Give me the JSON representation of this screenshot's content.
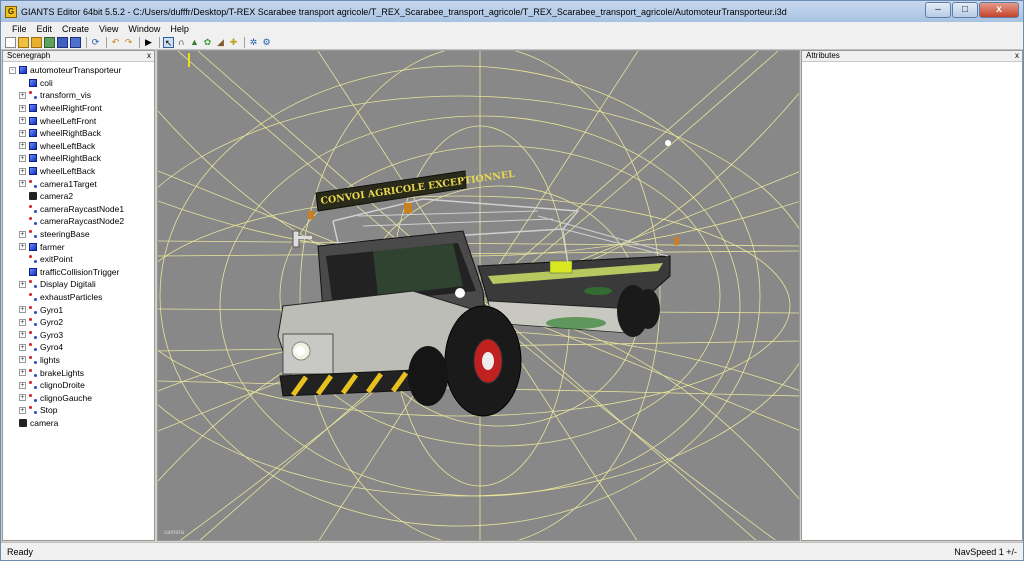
{
  "window": {
    "title": "GIANTS Editor 64bit 5.5.2 - C:/Users/dufffr/Desktop/T-REX Scarabee transport agricole/T_REX_Scarabee_transport_agricole/T_REX_Scarabee_transport_agricole/AutomoteurTransporteur.i3d",
    "minimize": "–",
    "maximize": "□",
    "close": "x"
  },
  "menu": [
    "File",
    "Edit",
    "Create",
    "View",
    "Window",
    "Help"
  ],
  "scenegraph": {
    "title": "Scenegraph",
    "close": "x",
    "nodes": [
      {
        "label": "automoteurTransporteur",
        "depth": 0,
        "expand": "-",
        "icon": "shape"
      },
      {
        "label": "coli",
        "depth": 1,
        "expand": "",
        "icon": "shape"
      },
      {
        "label": "transform_vis",
        "depth": 1,
        "expand": "+",
        "icon": "transform"
      },
      {
        "label": "wheelRightFront",
        "depth": 1,
        "expand": "+",
        "icon": "shape"
      },
      {
        "label": "wheelLeftFront",
        "depth": 1,
        "expand": "+",
        "icon": "shape"
      },
      {
        "label": "wheelRightBack",
        "depth": 1,
        "expand": "+",
        "icon": "shape"
      },
      {
        "label": "wheelLeftBack",
        "depth": 1,
        "expand": "+",
        "icon": "shape"
      },
      {
        "label": "wheelRightBack",
        "depth": 1,
        "expand": "+",
        "icon": "shape"
      },
      {
        "label": "wheelLeftBack",
        "depth": 1,
        "expand": "+",
        "icon": "shape"
      },
      {
        "label": "camera1Target",
        "depth": 1,
        "expand": "+",
        "icon": "transform"
      },
      {
        "label": "camera2",
        "depth": 1,
        "expand": "",
        "icon": "camera"
      },
      {
        "label": "cameraRaycastNode1",
        "depth": 1,
        "expand": "",
        "icon": "transform"
      },
      {
        "label": "cameraRaycastNode2",
        "depth": 1,
        "expand": "",
        "icon": "transform"
      },
      {
        "label": "steeringBase",
        "depth": 1,
        "expand": "+",
        "icon": "transform"
      },
      {
        "label": "farmer",
        "depth": 1,
        "expand": "+",
        "icon": "shape"
      },
      {
        "label": "exitPoint",
        "depth": 1,
        "expand": "",
        "icon": "transform"
      },
      {
        "label": "trafficCollisionTrigger",
        "depth": 1,
        "expand": "",
        "icon": "shape"
      },
      {
        "label": "Display Digitali",
        "depth": 1,
        "expand": "+",
        "icon": "transform"
      },
      {
        "label": "exhaustParticles",
        "depth": 1,
        "expand": "",
        "icon": "transform"
      },
      {
        "label": "Gyro1",
        "depth": 1,
        "expand": "+",
        "icon": "transform"
      },
      {
        "label": "Gyro2",
        "depth": 1,
        "expand": "+",
        "icon": "transform"
      },
      {
        "label": "Gyro3",
        "depth": 1,
        "expand": "+",
        "icon": "transform"
      },
      {
        "label": "Gyro4",
        "depth": 1,
        "expand": "+",
        "icon": "transform"
      },
      {
        "label": "lights",
        "depth": 1,
        "expand": "+",
        "icon": "transform"
      },
      {
        "label": "brakeLights",
        "depth": 1,
        "expand": "+",
        "icon": "transform"
      },
      {
        "label": "clignoDroite",
        "depth": 1,
        "expand": "+",
        "icon": "transform"
      },
      {
        "label": "clignoGauche",
        "depth": 1,
        "expand": "+",
        "icon": "transform"
      },
      {
        "label": "Stop",
        "depth": 1,
        "expand": "+",
        "icon": "transform"
      },
      {
        "label": "camera",
        "depth": 0,
        "expand": "",
        "icon": "camera"
      }
    ]
  },
  "viewport": {
    "camera_label": "camera",
    "vehicle_sign": "CONVOI AGRICOLE EXCEPTIONNEL",
    "background": "#888888",
    "gizmo_color": "#e8e59a"
  },
  "attributes": {
    "title": "Attributes",
    "close": "x"
  },
  "status": {
    "left": "Ready",
    "right": "NavSpeed 1 +/-"
  }
}
